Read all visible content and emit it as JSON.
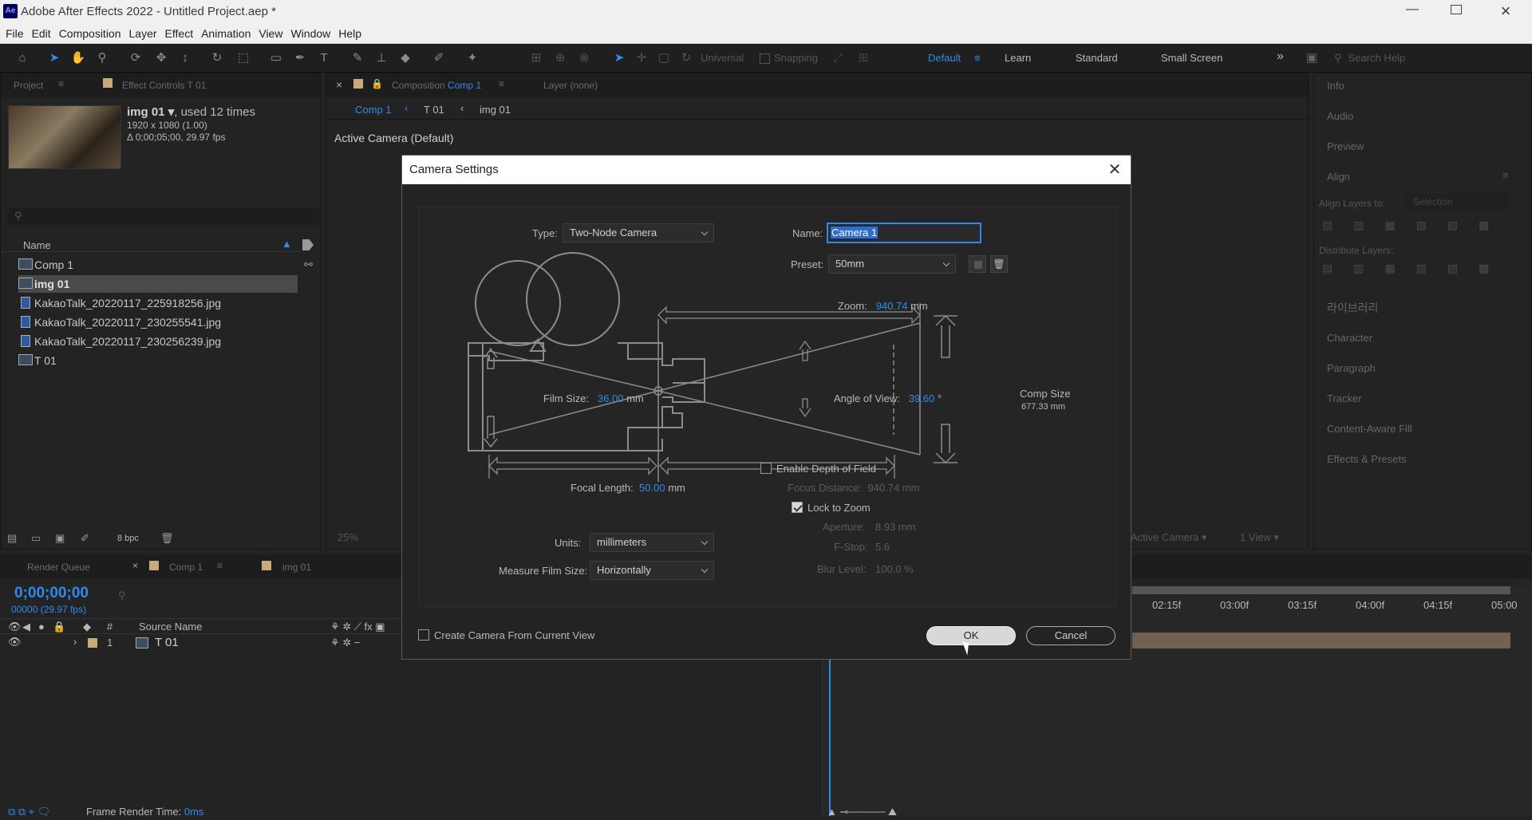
{
  "titlebar": {
    "app_icon": "Ae",
    "title": "Adobe After Effects 2022 - Untitled Project.aep *"
  },
  "menu": [
    "File",
    "Edit",
    "Composition",
    "Layer",
    "Effect",
    "Animation",
    "View",
    "Window",
    "Help"
  ],
  "toolbar": {
    "universal_label": "Universal",
    "snapping_label": "Snapping",
    "workspaces": [
      "Default",
      "Learn",
      "Standard",
      "Small Screen"
    ],
    "search_placeholder": "Search Help"
  },
  "project_panel": {
    "tab_project": "Project",
    "tab_effect_controls": "Effect Controls T 01",
    "item_name": "img 01",
    "item_used": ", used 12 times",
    "item_dims": "1920 x 1080 (1.00)",
    "item_duration": "Δ 0;00;05;00, 29.97 fps",
    "search_placeholder": "",
    "col_name": "Name",
    "items": [
      "Comp 1",
      "img 01",
      "KakaoTalk_20220117_225918256.jpg",
      "KakaoTalk_20220117_230255541.jpg",
      "KakaoTalk_20220117_230256239.jpg",
      "T 01"
    ],
    "bpc": "8 bpc"
  },
  "comp_panel": {
    "close": "×",
    "tab_composition": "Composition",
    "tab_comp_name": "Comp 1",
    "tab_layer": "Layer (none)",
    "breadcrumb": [
      "Comp 1",
      "T 01",
      "img 01"
    ],
    "active_camera": "Active Camera (Default)",
    "zoom": "25%",
    "view_camera": "Active Camera",
    "view_count": "1 View"
  },
  "right_panels": {
    "items": [
      "Info",
      "Audio",
      "Preview",
      "Align",
      "라이브러리",
      "Character",
      "Paragraph",
      "Tracker",
      "Content-Aware Fill",
      "Effects & Presets"
    ],
    "align_layers_to": "Align Layers to:",
    "align_target": "Selection",
    "distribute_layers": "Distribute Layers:"
  },
  "timeline": {
    "tab_render_queue": "Render Queue",
    "tab_comp": "Comp 1",
    "tab_img": "img 01",
    "timecode": "0;00;00;00",
    "frames": "00000 (29.97 fps)",
    "col_num": "#",
    "col_source": "Source Name",
    "layer_num": "1",
    "layer_name": "T 01",
    "ruler": [
      "02:15f",
      "03:00f",
      "03:15f",
      "04:00f",
      "04:15f",
      "05:00"
    ],
    "frame_render_label": "Frame Render Time:",
    "frame_render_value": "0ms"
  },
  "dialog": {
    "title": "Camera Settings",
    "type_label": "Type:",
    "type_value": "Two-Node Camera",
    "name_label": "Name:",
    "name_value": "Camera 1",
    "preset_label": "Preset:",
    "preset_value": "50mm",
    "zoom_label": "Zoom:",
    "zoom_value": "940.74",
    "zoom_unit": "mm",
    "film_size_label": "Film Size:",
    "film_size_value": "36.00",
    "film_size_unit": "mm",
    "angle_label": "Angle of View:",
    "angle_value": "39.60",
    "angle_unit": "°",
    "comp_size_label": "Comp Size",
    "comp_size_value": "677.33 mm",
    "focal_label": "Focal Length:",
    "focal_value": "50.00",
    "focal_unit": "mm",
    "dof_label": "Enable Depth of Field",
    "focus_distance_label": "Focus Distance:",
    "focus_distance_value": "940.74 mm",
    "lock_zoom_label": "Lock to Zoom",
    "units_label": "Units:",
    "units_value": "millimeters",
    "measure_label": "Measure Film Size:",
    "measure_value": "Horizontally",
    "aperture_label": "Aperture:",
    "aperture_value": "8.93 mm",
    "fstop_label": "F-Stop:",
    "fstop_value": "5.6",
    "blur_label": "Blur Level:",
    "blur_value": "100.0 %",
    "create_from_view_label": "Create Camera From Current View",
    "ok_label": "OK",
    "cancel_label": "Cancel"
  }
}
